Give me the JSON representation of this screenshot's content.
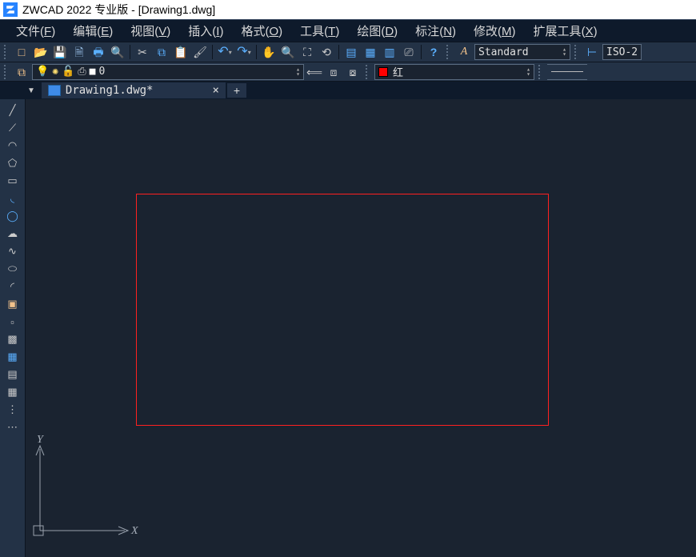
{
  "titlebar": {
    "title": "ZWCAD 2022 专业版 - [Drawing1.dwg]"
  },
  "menu": {
    "file": {
      "label": "文件",
      "hotkey": "F"
    },
    "edit": {
      "label": "编辑",
      "hotkey": "E"
    },
    "view": {
      "label": "视图",
      "hotkey": "V"
    },
    "insert": {
      "label": "插入",
      "hotkey": "I"
    },
    "format": {
      "label": "格式",
      "hotkey": "O"
    },
    "tools": {
      "label": "工具",
      "hotkey": "T"
    },
    "draw": {
      "label": "绘图",
      "hotkey": "D"
    },
    "dim": {
      "label": "标注",
      "hotkey": "N"
    },
    "modify": {
      "label": "修改",
      "hotkey": "M"
    },
    "ext": {
      "label": "扩展工具",
      "hotkey": "X"
    }
  },
  "toolbar1": {
    "text_style_label": "Standard",
    "dim_style_label": "ISO-2"
  },
  "toolbar2": {
    "layer_name": "0",
    "color_name": "红"
  },
  "tab": {
    "doc_name": "Drawing1.dwg*",
    "close_glyph": "×",
    "new_glyph": "+"
  },
  "ucs": {
    "x_label": "X",
    "y_label": "Y"
  },
  "icons": {
    "new": "□",
    "open": "📂",
    "save": "💾",
    "saveas": "🗎",
    "plot": "🖶",
    "preview": "🔍",
    "cut": "✂",
    "copy": "⧉",
    "paste": "📋",
    "match": "🖌",
    "undo": "↶",
    "redo": "↷",
    "pan": "✋",
    "zoomrt": "🔍",
    "zoomwin": "⛶",
    "zoomprev": "⟲",
    "props": "▤",
    "design": "▦",
    "tool": "▥",
    "clean": "⎚",
    "help": "?",
    "textstyle": "A",
    "dimstyle": "⊢",
    "layermgr": "⧉",
    "bulb": "💡",
    "sun": "✺",
    "lock": "🔓",
    "plot2": "⎙",
    "layercolor": "■",
    "layerprev": "⟸",
    "layeriso": "⧈",
    "layerunhide": "⧇",
    "line": "╱",
    "cline": "⟋",
    "arc": "◠",
    "poly": "⬠",
    "rect": "▭",
    "arc2": "◟",
    "circle": "◯",
    "revcl": "☁",
    "spline": "∿",
    "ellipse": "⬭",
    "earc": "◜",
    "block": "▣",
    "point": "▫",
    "hatch": "▩",
    "grad": "▦",
    "region": "▤",
    "table": "▦",
    "hatch2": "⋮",
    "more": "⋯"
  }
}
